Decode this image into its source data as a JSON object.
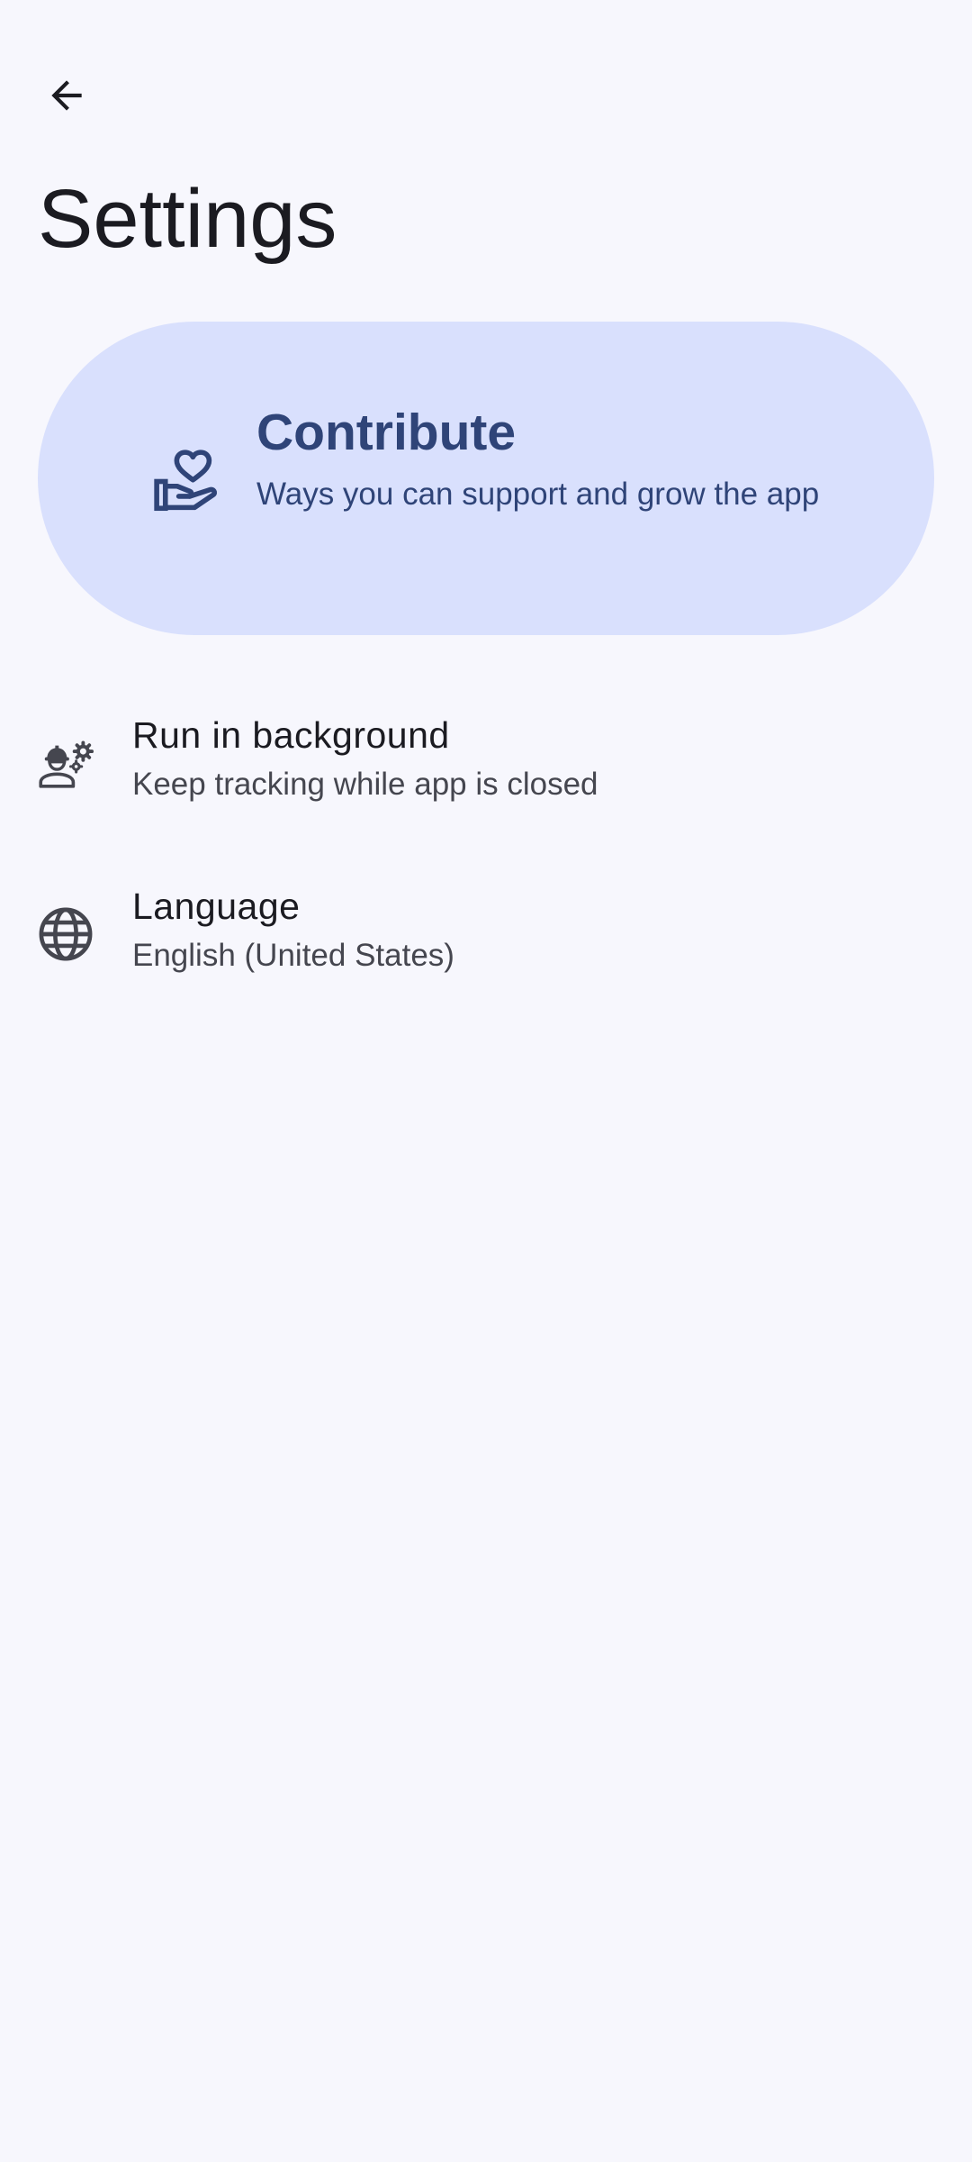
{
  "header": {
    "title": "Settings"
  },
  "contribute": {
    "title": "Contribute",
    "description": "Ways you can support and grow the app"
  },
  "settings": [
    {
      "title": "Run in background",
      "subtitle": "Keep tracking while app is closed",
      "icon": "worker-gears-icon"
    },
    {
      "title": "Language",
      "subtitle": "English (United States)",
      "icon": "globe-icon"
    }
  ],
  "colors": {
    "background": "#f7f7fd",
    "card_background": "#d9e0fd",
    "card_accent": "#2f4478",
    "text_primary": "#1b1b21",
    "text_secondary": "#45464f"
  }
}
